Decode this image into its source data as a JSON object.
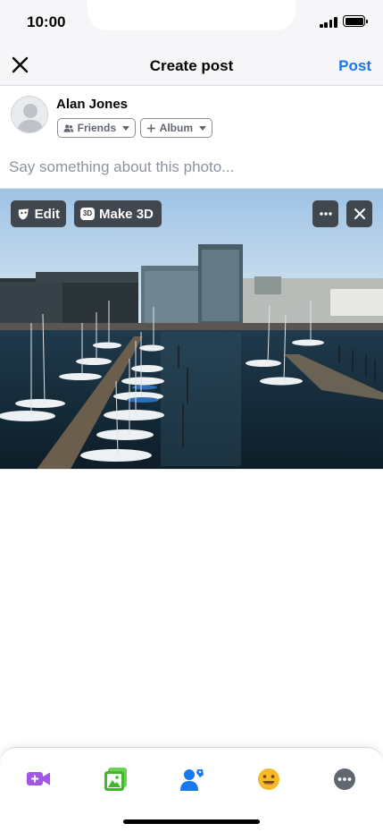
{
  "status_bar": {
    "time": "10:00"
  },
  "header": {
    "title": "Create post",
    "post_label": "Post"
  },
  "composer": {
    "user_name": "Alan Jones",
    "audience_label": "Friends",
    "album_label": "Album",
    "caption_placeholder": "Say something about this photo..."
  },
  "photo_overlay": {
    "edit_label": "Edit",
    "make3d_label": "Make 3D",
    "badge_3d": "3D"
  },
  "toolbar": {
    "items": [
      {
        "icon": "video-icon",
        "color": "#a056e8"
      },
      {
        "icon": "photo-icon",
        "color": "#42b72a"
      },
      {
        "icon": "tag-people-icon",
        "color": "#1877f2"
      },
      {
        "icon": "feeling-icon",
        "color": "#f7b928"
      },
      {
        "icon": "more-icon",
        "color": "#606770"
      }
    ]
  },
  "colors": {
    "accent": "#1877f2",
    "placeholder": "#8d949e"
  }
}
